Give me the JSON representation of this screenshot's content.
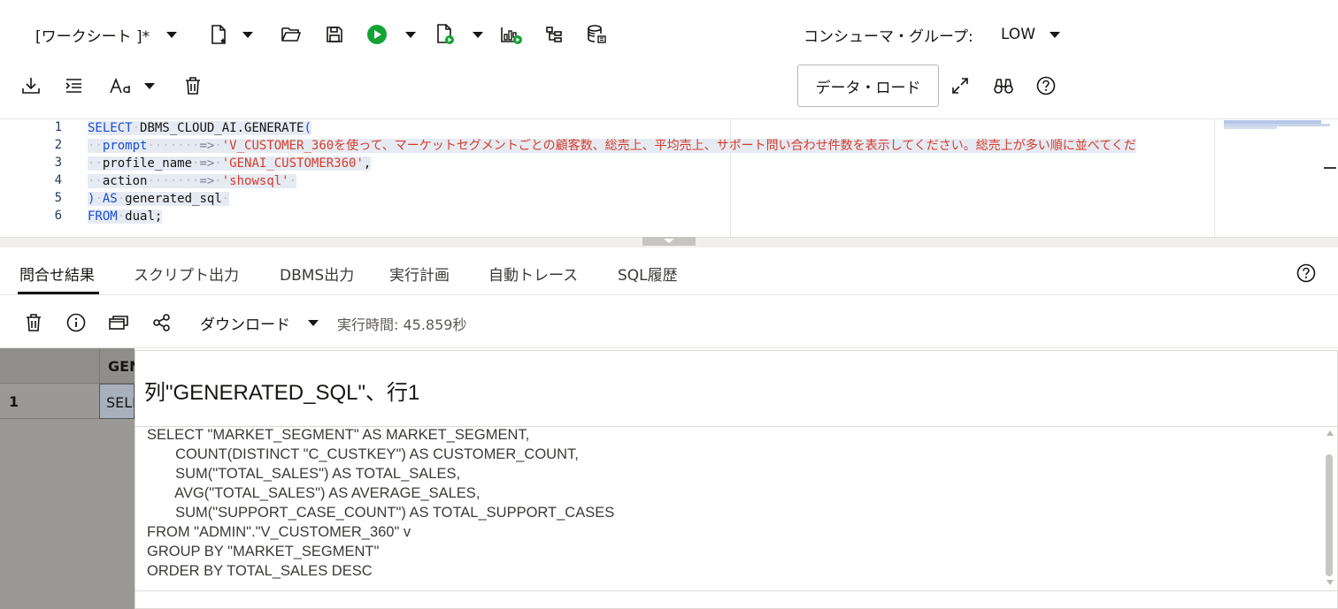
{
  "toolbar": {
    "worksheet_label": "[ワークシート ]*",
    "consumer_group_label": "コンシューマ・グループ:",
    "consumer_group_value": "LOW",
    "data_load_label": "データ・ロード"
  },
  "editor": {
    "line_numbers": [
      "1",
      "2",
      "3",
      "4",
      "5",
      "6"
    ],
    "code": {
      "l1_kw": "SELECT",
      "l1_fn": "DBMS_CLOUD_AI.GENERATE",
      "l1_paren": "(",
      "l2_param": "prompt",
      "l2_arrow": "=>",
      "l2_value": "'V_CUSTOMER_360を使って、マーケットセグメントごとの顧客数、総売上、平均売上、サポート問い合わせ件数を表示してください。総売上が多い順に並べてくだ",
      "l3_param": "profile_name",
      "l3_arrow": "=>",
      "l3_value": "'GENAI_CUSTOMER360'",
      "l3_comma": ",",
      "l4_param": "action",
      "l4_arrow": "=>",
      "l4_value": "'showsql'",
      "l5_paren": ")",
      "l5_kw": "AS",
      "l5_alias": "generated_sql",
      "l6_kw": "FROM",
      "l6_table": "dual;"
    }
  },
  "tabs": [
    {
      "label": "問合せ結果",
      "active": true
    },
    {
      "label": "スクリプト出力",
      "active": false
    },
    {
      "label": "DBMS出力",
      "active": false
    },
    {
      "label": "実行計画",
      "active": false
    },
    {
      "label": "自動トレース",
      "active": false
    },
    {
      "label": "SQL履歴",
      "active": false
    }
  ],
  "results_toolbar": {
    "download_label": "ダウンロード",
    "exec_time": "実行時間: 45.859秒"
  },
  "grid": {
    "column_header": "GENERATED_SQL",
    "row_number": "1",
    "cell_value": "SELECT"
  },
  "popup": {
    "title": "列\"GENERATED_SQL\"、行1",
    "sql_text": "SELECT \"MARKET_SEGMENT\" AS MARKET_SEGMENT,\n       COUNT(DISTINCT \"C_CUSTKEY\") AS CUSTOMER_COUNT,\n       SUM(\"TOTAL_SALES\") AS TOTAL_SALES,\n       AVG(\"TOTAL_SALES\") AS AVERAGE_SALES,\n       SUM(\"SUPPORT_CASE_COUNT\") AS TOTAL_SUPPORT_CASES\nFROM \"ADMIN\".\"V_CUSTOMER_360\" v\nGROUP BY \"MARKET_SEGMENT\"\nORDER BY TOTAL_SALES DESC"
  },
  "icons": {
    "new-worksheet": "new-file-icon",
    "open": "folder-open-icon",
    "save": "save-icon",
    "run-statement": "play-icon",
    "run-script": "run-script-icon",
    "explain-plan": "explain-plan-icon",
    "autotrace": "autotrace-icon",
    "sql-history": "database-icon",
    "download": "download-icon",
    "format": "format-indent-icon",
    "font": "font-size-icon",
    "clear": "trash-icon",
    "expand": "expand-icon",
    "find": "binoculars-icon",
    "help": "help-icon"
  },
  "colors": {
    "run_green": "#13a334",
    "keyword_blue": "#1a4fd6",
    "string_red": "#d63b2a"
  }
}
